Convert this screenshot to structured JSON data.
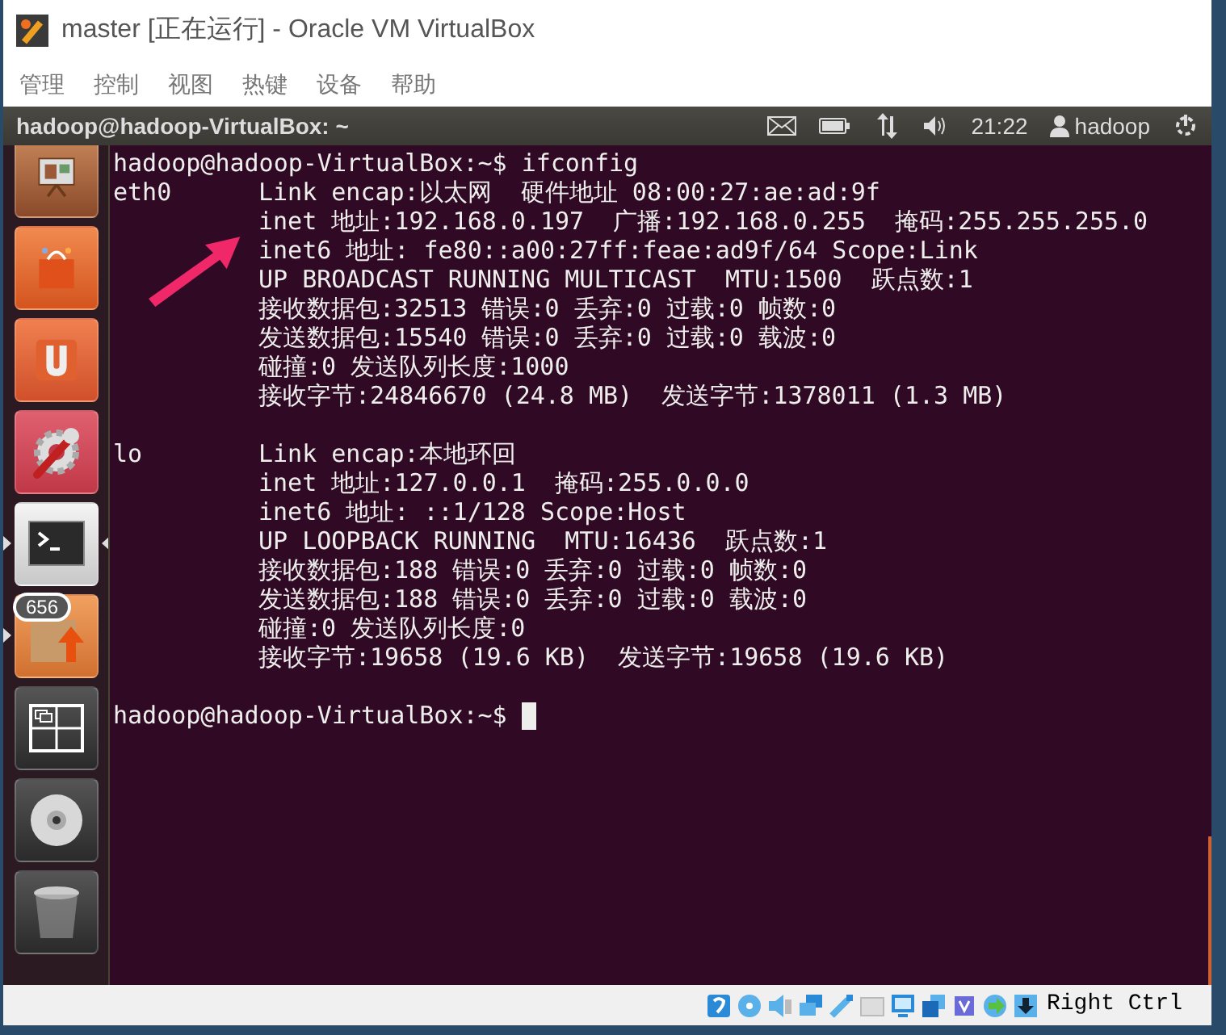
{
  "window": {
    "title": "master [正在运行] - Oracle VM VirtualBox"
  },
  "menu": [
    "管理",
    "控制",
    "视图",
    "热键",
    "设备",
    "帮助"
  ],
  "panel": {
    "title": "hadoop@hadoop-VirtualBox: ~",
    "clock": "21:22",
    "user": "hadoop"
  },
  "launcher": [
    {
      "kind": "presentation",
      "running": false,
      "focused": false
    },
    {
      "kind": "store",
      "running": false,
      "focused": false
    },
    {
      "kind": "u",
      "running": false,
      "focused": false
    },
    {
      "kind": "settings",
      "running": false,
      "focused": false
    },
    {
      "kind": "terminal",
      "running": true,
      "focused": true
    },
    {
      "kind": "updates",
      "running": true,
      "focused": false,
      "badge": "656"
    },
    {
      "kind": "workspaces",
      "running": false,
      "focused": false
    },
    {
      "kind": "disc",
      "running": false,
      "focused": false
    },
    {
      "kind": "trash",
      "running": false,
      "focused": false
    }
  ],
  "terminal": [
    {
      "kind": "prompt",
      "prompt": "hadoop@hadoop-VirtualBox:~$",
      "command": "ifconfig",
      "cursor": false
    },
    {
      "kind": "interface",
      "name": "eth0",
      "lines": [
        "Link encap:以太网  硬件地址 08:00:27:ae:ad:9f",
        "inet 地址:192.168.0.197  广播:192.168.0.255  掩码:255.255.255.0",
        "inet6 地址: fe80::a00:27ff:feae:ad9f/64 Scope:Link",
        "UP BROADCAST RUNNING MULTICAST  MTU:1500  跃点数:1",
        "接收数据包:32513 错误:0 丢弃:0 过载:0 帧数:0",
        "发送数据包:15540 错误:0 丢弃:0 过载:0 载波:0",
        "碰撞:0 发送队列长度:1000",
        "接收字节:24846670 (24.8 MB)  发送字节:1378011 (1.3 MB)"
      ]
    },
    {
      "kind": "interface",
      "name": "lo",
      "lines": [
        "Link encap:本地环回",
        "inet 地址:127.0.0.1  掩码:255.0.0.0",
        "inet6 地址: ::1/128 Scope:Host",
        "UP LOOPBACK RUNNING  MTU:16436  跃点数:1",
        "接收数据包:188 错误:0 丢弃:0 过载:0 帧数:0",
        "发送数据包:188 错误:0 丢弃:0 过载:0 载波:0",
        "碰撞:0 发送队列长度:0",
        "接收字节:19658 (19.6 KB)  发送字节:19658 (19.6 KB)"
      ]
    },
    {
      "kind": "prompt",
      "prompt": "hadoop@hadoop-VirtualBox:~$",
      "cursor": true
    }
  ],
  "status_bar": {
    "host_key": "Right Ctrl"
  }
}
